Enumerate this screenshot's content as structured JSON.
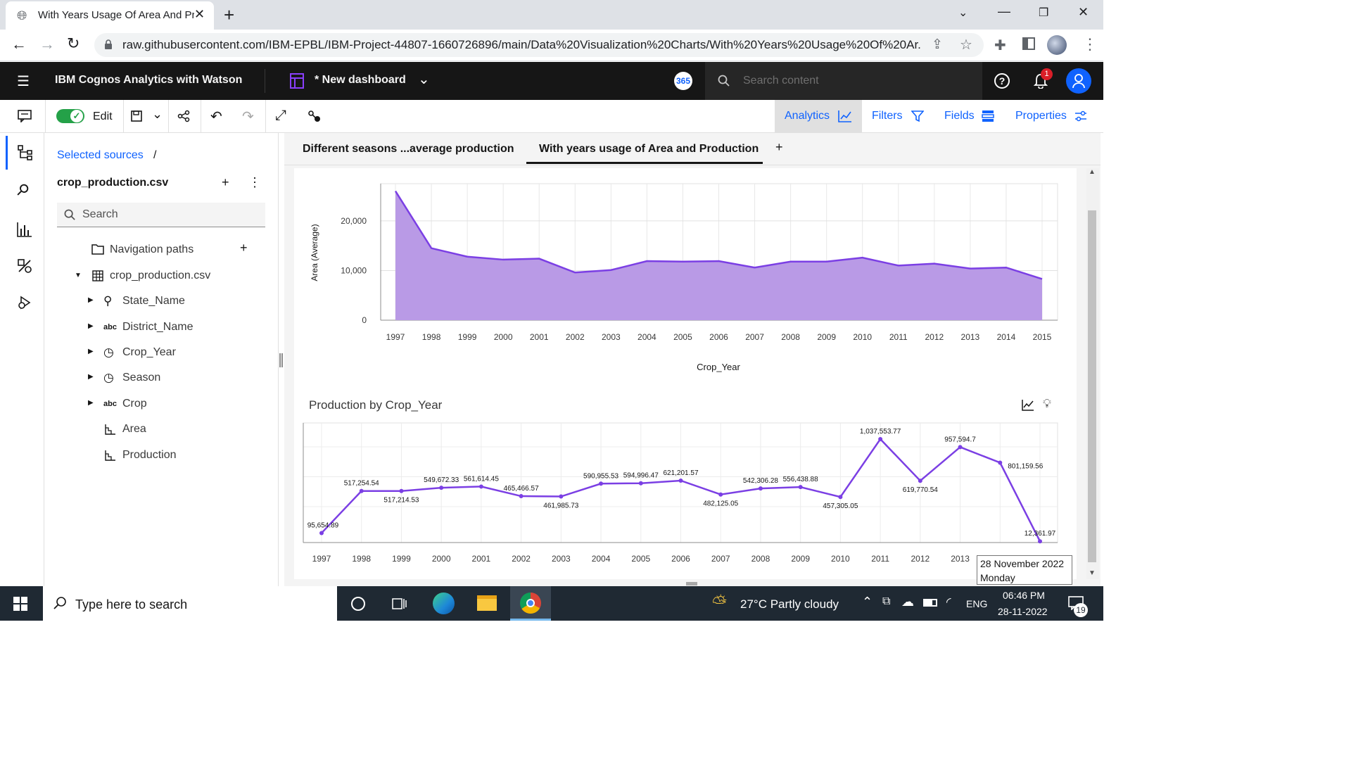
{
  "browser": {
    "tab_title": "With Years Usage Of Area And Pr",
    "url": "raw.githubusercontent.com/IBM-EPBL/IBM-Project-44807-1660726896/main/Data%20Visualization%20Charts/With%20Years%20Usage%20Of%20Ar..."
  },
  "app": {
    "product_name": "IBM Cognos Analytics with Watson",
    "dashboard_name": "* New dashboard",
    "badge_365": "365",
    "search_placeholder": "Search content",
    "notification_count": "1"
  },
  "toolbar": {
    "edit_label": "Edit",
    "analytics_label": "Analytics",
    "filters_label": "Filters",
    "fields_label": "Fields",
    "properties_label": "Properties"
  },
  "sources": {
    "breadcrumb": "Selected sources",
    "breadcrumb_sep": "/",
    "file_name": "crop_production.csv",
    "search_placeholder": "Search",
    "navigation_paths": "Navigation paths",
    "table_name": "crop_production.csv",
    "fields": [
      {
        "label": "State_Name",
        "icon": "location-pin-icon"
      },
      {
        "label": "District_Name",
        "icon": "abc-icon"
      },
      {
        "label": "Crop_Year",
        "icon": "clock-icon"
      },
      {
        "label": "Season",
        "icon": "clock-icon"
      },
      {
        "label": "Crop",
        "icon": "abc-icon"
      },
      {
        "label": "Area",
        "icon": "measure-icon"
      },
      {
        "label": "Production",
        "icon": "measure-icon"
      }
    ]
  },
  "tabs": [
    {
      "label": "Different seasons ...average production",
      "active": false
    },
    {
      "label": "With years usage of Area and Production",
      "active": true
    }
  ],
  "chart_data": [
    {
      "type": "area",
      "title": "",
      "xlabel": "Crop_Year",
      "ylabel": "Area (Average)",
      "x": [
        "1997",
        "1998",
        "1999",
        "2000",
        "2001",
        "2002",
        "2003",
        "2004",
        "2005",
        "2006",
        "2007",
        "2008",
        "2009",
        "2010",
        "2011",
        "2012",
        "2013",
        "2014",
        "2015"
      ],
      "values": [
        26000,
        14500,
        12800,
        12200,
        12400,
        9600,
        10100,
        11900,
        11800,
        11900,
        10600,
        11800,
        11800,
        12600,
        11000,
        11400,
        10400,
        10600,
        8300
      ],
      "yticks": [
        "0",
        "10,000",
        "20,000"
      ],
      "ylim": [
        0,
        27500
      ],
      "grid": true,
      "color": "#b99ae6",
      "line_color": "#7b3fe4"
    },
    {
      "type": "line",
      "title": "Production by Crop_Year",
      "xlabel": "",
      "ylabel": "",
      "x": [
        "1997",
        "1998",
        "1999",
        "2000",
        "2001",
        "2002",
        "2003",
        "2004",
        "2005",
        "2006",
        "2007",
        "2008",
        "2009",
        "2010",
        "2011",
        "2012",
        "2013",
        "2014",
        "2015"
      ],
      "values": [
        95654.89,
        517254.54,
        517214.53,
        549672.33,
        561614.45,
        465466.57,
        461985.73,
        590955.53,
        594996.47,
        621201.57,
        482125.05,
        542306.28,
        556438.88,
        457305.05,
        1037553.77,
        619770.54,
        957594.7,
        801159.56,
        12361.97
      ],
      "labels": [
        "95,654.89",
        "517,254.54",
        "517,214.53",
        "549,672.33",
        "561,614.45",
        "465,466.57",
        "461,985.73",
        "590,955.53",
        "594,996.47",
        "621,201.57",
        "482,125.05",
        "542,306.28",
        "556,438.88",
        "457,305.05",
        "1,037,553.77",
        "619,770.54",
        "957,594.7",
        "801,159.56",
        "12,361.97"
      ],
      "ylim": [
        0,
        1200000
      ],
      "grid": true,
      "color": "#7b3fe4"
    }
  ],
  "tooltip": {
    "line1": "28 November 2022",
    "line2": "Monday"
  },
  "taskbar": {
    "search_placeholder": "Type here to search",
    "weather": "27°C  Partly cloudy",
    "language": "ENG",
    "time": "06:46 PM",
    "date": "28-11-2022",
    "notification_count": "19"
  }
}
